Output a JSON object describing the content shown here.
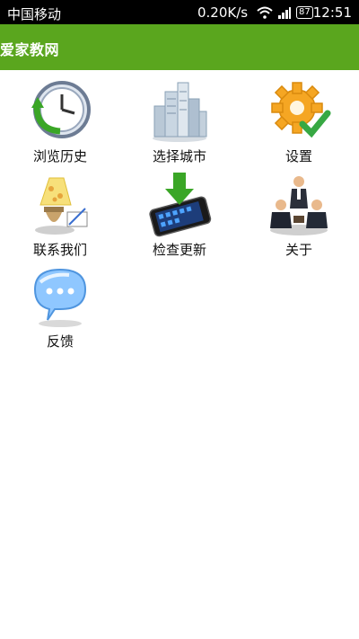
{
  "status_bar": {
    "carrier": "中国移动",
    "speed": "0.20K/s",
    "battery": "87",
    "time": "12:51",
    "icons": [
      "wifi-icon",
      "signal-icon",
      "battery-icon"
    ]
  },
  "header": {
    "title": "爱家教网"
  },
  "menu": {
    "items": [
      {
        "label": "浏览历史",
        "icon": "history-clock-icon"
      },
      {
        "label": "选择城市",
        "icon": "city-buildings-icon"
      },
      {
        "label": "设置",
        "icon": "settings-gear-icon"
      },
      {
        "label": "联系我们",
        "icon": "contact-lamp-icon"
      },
      {
        "label": "检查更新",
        "icon": "update-download-icon"
      },
      {
        "label": "关于",
        "icon": "about-people-icon"
      },
      {
        "label": "反馈",
        "icon": "feedback-bubble-icon"
      }
    ]
  },
  "colors": {
    "header_bg": "#5aa61e",
    "status_bg": "#000000"
  }
}
